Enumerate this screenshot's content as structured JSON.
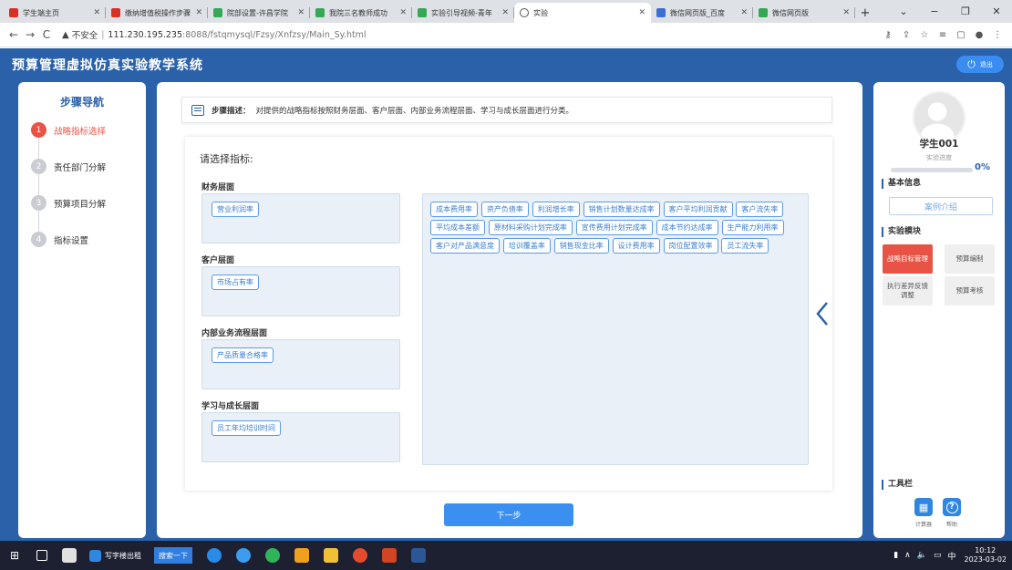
{
  "browser": {
    "tabs": [
      {
        "label": "学生端主页",
        "color": "#d93025",
        "active": false
      },
      {
        "label": "缴纳增值税操作步骤",
        "color": "#d93025",
        "active": false
      },
      {
        "label": "院部设置-许昌学院",
        "color": "#34a853",
        "active": false
      },
      {
        "label": "我院三名教师成功",
        "color": "#34a853",
        "active": false
      },
      {
        "label": "实验引导视频-青年",
        "color": "#34a853",
        "active": false
      },
      {
        "label": "实验",
        "color": "#ffffff",
        "active": true
      },
      {
        "label": "微信网页版_百度",
        "color": "#3b6fd8",
        "active": false
      },
      {
        "label": "微信网页版",
        "color": "#34a853",
        "active": false
      }
    ],
    "security_label": "不安全",
    "url_host": "111.230.195.235",
    "url_rest": ":8088/fstqmysql/Fzsy/Xnfzsy/Main_Sy.html"
  },
  "app": {
    "title": "预算管理虚拟仿真实验教学系统",
    "logout_label": "退出"
  },
  "steps": {
    "title": "步骤导航",
    "items": [
      {
        "num": "1",
        "label": "战略指标选择",
        "active": true
      },
      {
        "num": "2",
        "label": "责任部门分解",
        "active": false
      },
      {
        "num": "3",
        "label": "预算项目分解",
        "active": false
      },
      {
        "num": "4",
        "label": "指标设置",
        "active": false
      }
    ]
  },
  "main": {
    "desc_label": "步骤描述：",
    "desc_text": "对提供的战略指标按照财务层面、客户层面、内部业务流程层面、学习与成长层面进行分类。",
    "select_title": "请选择指标:",
    "categories": [
      {
        "label": "财务层面",
        "chips": [
          "营业利润率"
        ]
      },
      {
        "label": "客户层面",
        "chips": [
          "市场占有率"
        ]
      },
      {
        "label": "内部业务流程层面",
        "chips": [
          "产品质量合格率"
        ]
      },
      {
        "label": "学习与成长层面",
        "chips": [
          "员工年均培训时间"
        ]
      }
    ],
    "pool": [
      "成本费用率",
      "资产负债率",
      "利润增长率",
      "销售计划数量达成率",
      "客户平均利润贡献",
      "客户流失率",
      "平均成本差额",
      "原材料采购计划完成率",
      "宣传费用计划完成率",
      "成本节约达成率",
      "生产能力利用率",
      "客户对产品满意度",
      "培训覆盖率",
      "销售现金比率",
      "设计费用率",
      "岗位配置效率",
      "员工流失率"
    ],
    "next_label": "下一步"
  },
  "profile": {
    "name": "学生001",
    "progress_label": "实验进度",
    "progress_value": 0,
    "progress_text": "0%",
    "basic_info_title": "基本信息",
    "case_button": "案例介绍",
    "modules_title": "实验模块",
    "modules": [
      {
        "label": "战略目标管理",
        "active": true
      },
      {
        "label": "预算编制",
        "active": false
      },
      {
        "label": "执行差异反馈调整",
        "active": false
      },
      {
        "label": "预算考核",
        "active": false
      }
    ],
    "toolbar_title": "工具栏",
    "tools": [
      {
        "label": "计算器",
        "icon": "calculator-icon"
      },
      {
        "label": "帮助",
        "icon": "help-icon"
      }
    ]
  },
  "taskbar": {
    "browser_item": "写字楼出租",
    "search_label": "搜索一下",
    "ime": "中",
    "time": "10:12",
    "date": "2023-03-02"
  },
  "colors": {
    "brand": "#2a61a8",
    "accent_red": "#e95345",
    "button_blue": "#3b8ff0"
  }
}
